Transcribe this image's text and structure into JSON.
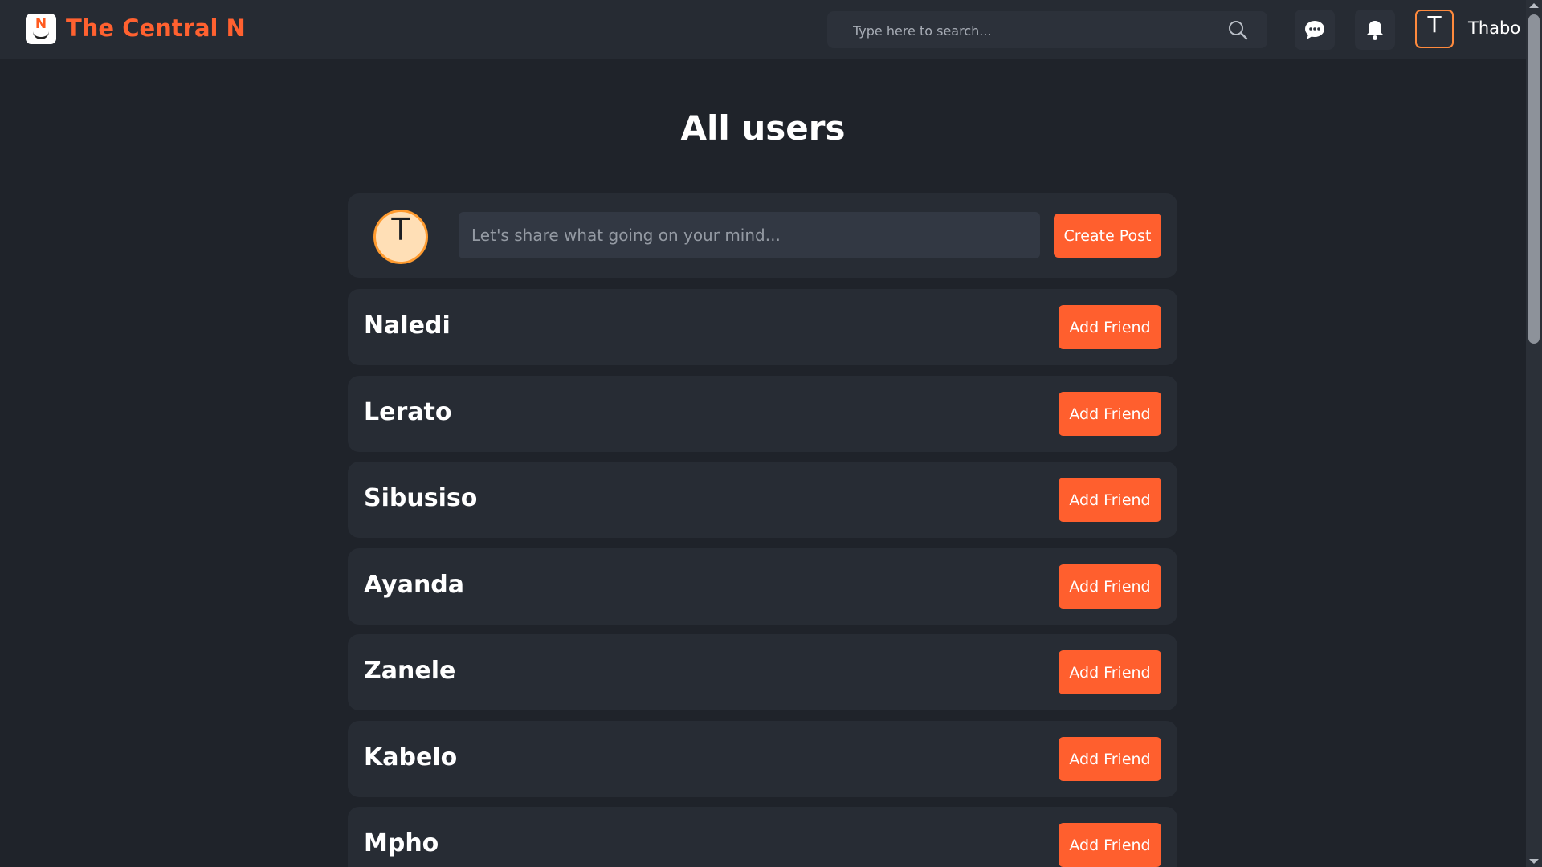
{
  "header": {
    "brand": "The Central N",
    "logo_letter": "N",
    "search_placeholder": "Type here to search...",
    "avatar_initial": "T",
    "username": "Thabo"
  },
  "main": {
    "title": "All users",
    "composer": {
      "avatar_initial": "T",
      "placeholder": "Let's share what going on your mind...",
      "button_label": "Create Post"
    },
    "users": [
      {
        "name": "Naledi",
        "action": "Add Friend"
      },
      {
        "name": "Lerato",
        "action": "Add Friend"
      },
      {
        "name": "Sibusiso",
        "action": "Add Friend"
      },
      {
        "name": "Ayanda",
        "action": "Add Friend"
      },
      {
        "name": "Zanele",
        "action": "Add Friend"
      },
      {
        "name": "Kabelo",
        "action": "Add Friend"
      },
      {
        "name": "Mpho",
        "action": "Add Friend"
      }
    ]
  },
  "colors": {
    "accent": "#ff5f2e",
    "background": "#1f232a",
    "card": "#272c34"
  },
  "icons": [
    "search-icon",
    "chat-icon",
    "bell-icon"
  ]
}
